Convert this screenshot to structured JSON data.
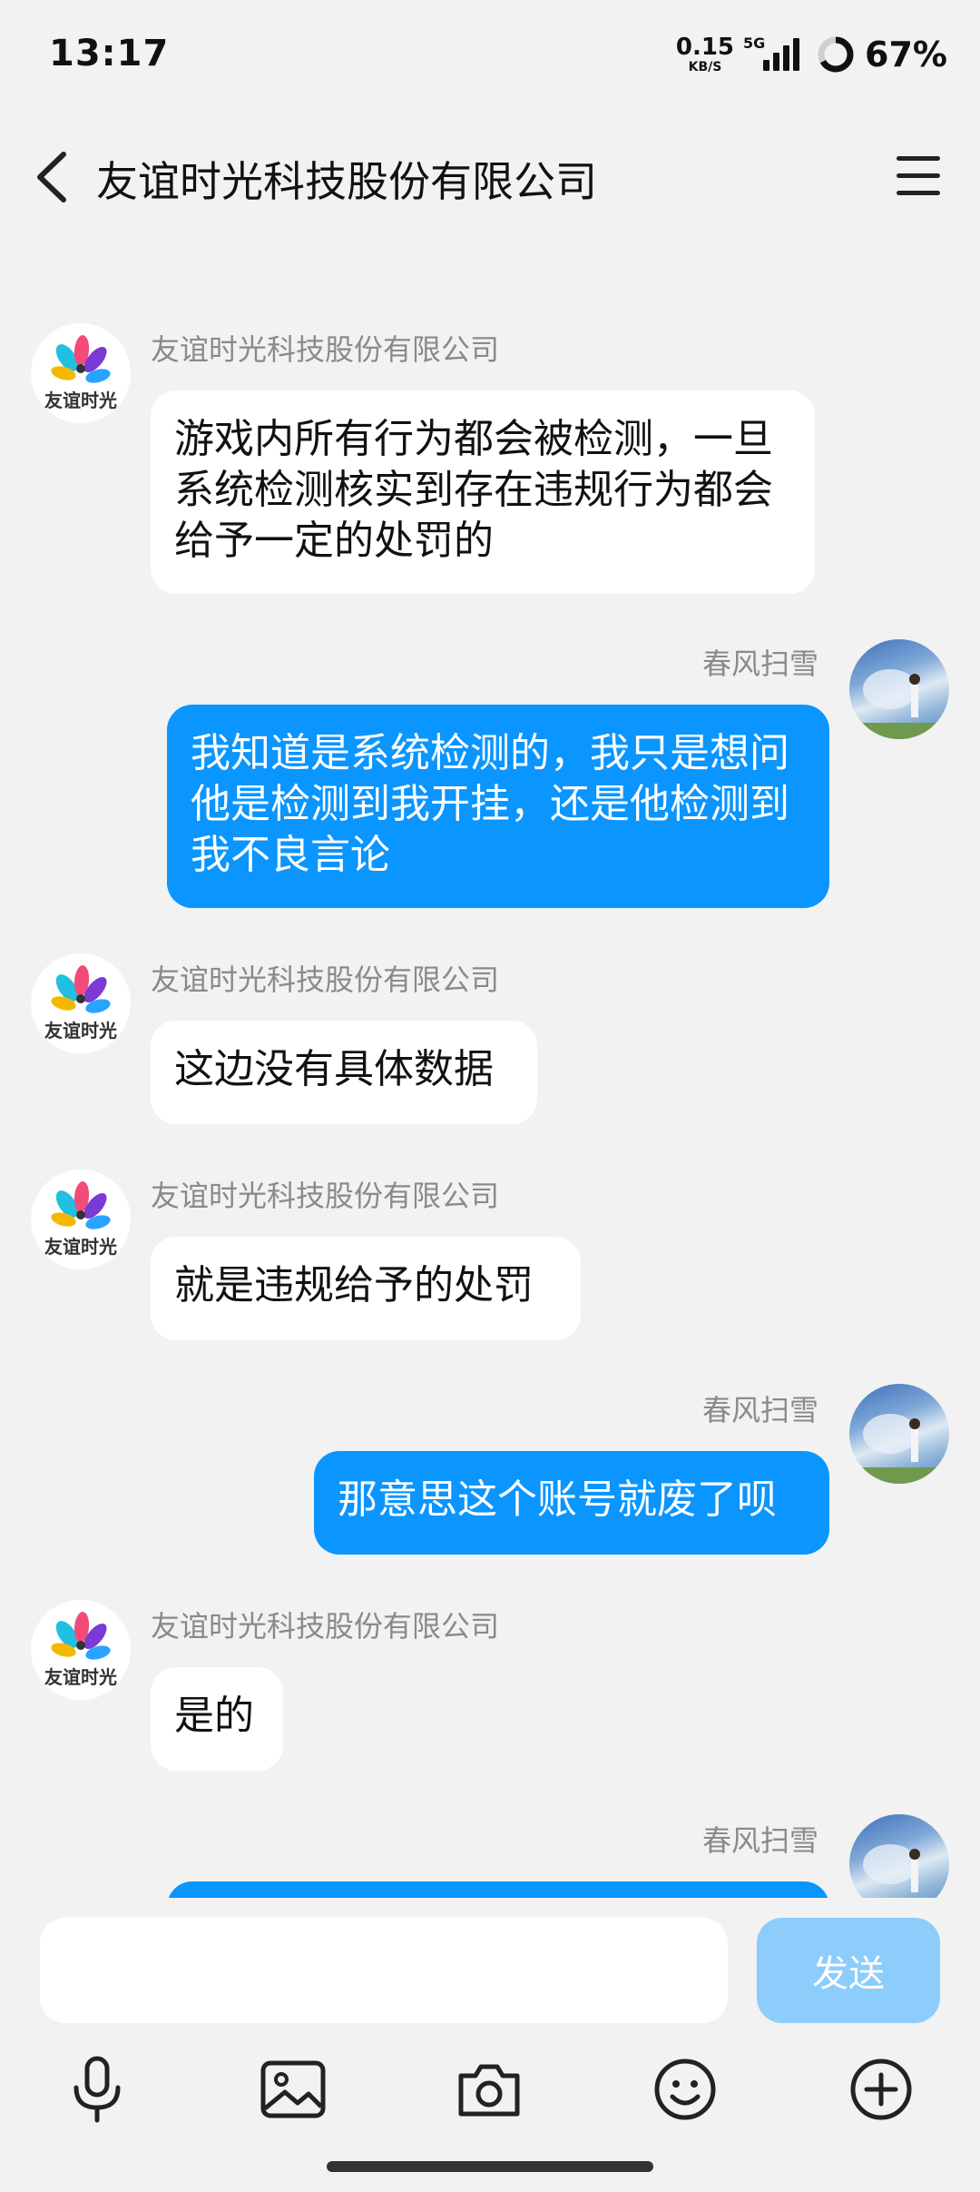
{
  "status_bar": {
    "time": "13:17",
    "speed_value": "0.15",
    "speed_unit": "KB/S",
    "network": "5G",
    "battery": "67%"
  },
  "header": {
    "title": "友谊时光科技股份有限公司",
    "back_icon": "chevron-left-icon",
    "menu_icon": "menu-icon"
  },
  "company": {
    "name": "友谊时光科技股份有限公司",
    "logo_text": "友谊时光"
  },
  "user": {
    "name": "春风扫雪"
  },
  "messages": [
    {
      "from": "company",
      "sender": "友谊时光科技股份有限公司",
      "text": "游戏内所有行为都会被检测，一旦系统检测核实到存在违规行为都会给予一定的处罚的"
    },
    {
      "from": "user",
      "sender": "春风扫雪",
      "text": "我知道是系统检测的，我只是想问他是检测到我开挂，还是他检测到我不良言论"
    },
    {
      "from": "company",
      "sender": "友谊时光科技股份有限公司",
      "text": "这边没有具体数据"
    },
    {
      "from": "company",
      "sender": "友谊时光科技股份有限公司",
      "text": "就是违规给予的处罚"
    },
    {
      "from": "user",
      "sender": "春风扫雪",
      "text": "那意思这个账号就废了呗"
    },
    {
      "from": "company",
      "sender": "友谊时光科技股份有限公司",
      "text": "是的"
    },
    {
      "from": "user",
      "sender": "春风扫雪",
      "text": ""
    }
  ],
  "input": {
    "value": "",
    "placeholder": ""
  },
  "send_label": "发送",
  "toolbar": [
    "microphone-icon",
    "image-icon",
    "camera-icon",
    "emoji-icon",
    "plus-circle-icon"
  ],
  "colors": {
    "background": "#f2f2f2",
    "incoming_bubble": "#ffffff",
    "outgoing_bubble": "#0a95ff",
    "send_button": "#8ccdfb",
    "name_text": "#8a8a8a"
  }
}
